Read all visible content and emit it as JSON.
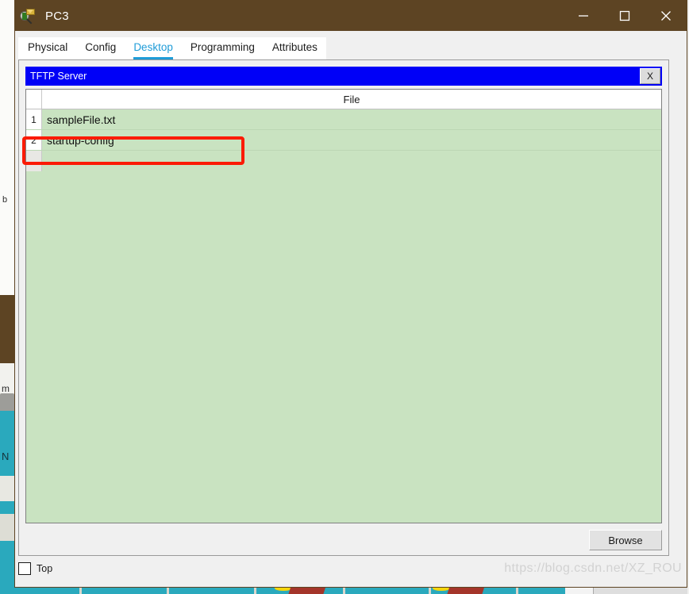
{
  "window": {
    "title": "PC3",
    "icon": "packet-tracer-inspect-icon",
    "titlebar_color": "#5d4423",
    "controls": {
      "minimize": "minimize-icon",
      "maximize": "maximize-icon",
      "close": "close-icon"
    }
  },
  "tabs": [
    {
      "label": "Physical",
      "active": false
    },
    {
      "label": "Config",
      "active": false
    },
    {
      "label": "Desktop",
      "active": true
    },
    {
      "label": "Programming",
      "active": false
    },
    {
      "label": "Attributes",
      "active": false
    }
  ],
  "tab_active_color": "#1f9cd8",
  "tftp": {
    "title": "TFTP Server",
    "titlebar_color": "#0000f7",
    "close_label": "X",
    "table": {
      "columns": [
        "",
        "File"
      ],
      "rows": [
        {
          "num": "1",
          "file": "sampleFile.txt"
        },
        {
          "num": "2",
          "file": "startup-config"
        }
      ],
      "row_background": "#c9e3c1"
    },
    "browse_label": "Browse"
  },
  "footer": {
    "top_checkbox_label": "Top",
    "top_checked": false
  },
  "annotation": {
    "type": "red-rectangle-highlight",
    "target_row": "startup-config",
    "color": "#fb1b05"
  },
  "watermark": "https://blog.csdn.net/XZ_ROU"
}
